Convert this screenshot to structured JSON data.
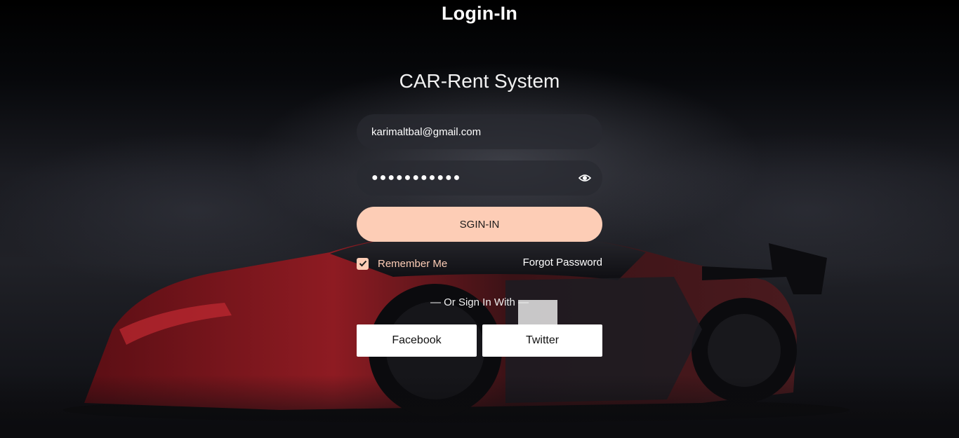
{
  "page": {
    "title": "Login-In"
  },
  "brand": {
    "name": "CAR-Rent System"
  },
  "form": {
    "email_value": "karimaltbal@gmail.com",
    "password_value": "●●●●●●●●●●●",
    "password_toggle_icon": "eye-icon",
    "signin_label": "SGIN-IN",
    "remember_label": "Remember Me",
    "remember_checked": true,
    "forgot_label": "Forgot Password"
  },
  "social": {
    "divider_text": "— Or Sign In With —",
    "facebook_label": "Facebook",
    "twitter_label": "Twitter"
  },
  "colors": {
    "accent": "#fdcdb6",
    "field_bg": "#2a2c31",
    "car_red": "#8e1b22"
  }
}
